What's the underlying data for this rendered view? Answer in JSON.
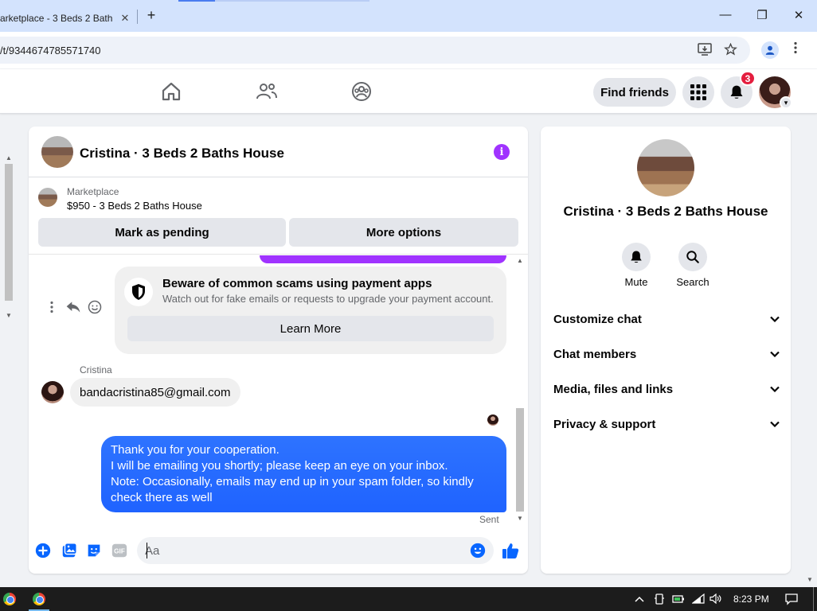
{
  "browser": {
    "tab_title": "arketplace - 3 Beds 2 Bath",
    "tab_close": "✕",
    "new_tab": "+",
    "url": "/t/9344674785571740",
    "window": {
      "minimize": "—",
      "restore": "❐",
      "close": "✕"
    }
  },
  "nav": {
    "find_friends": "Find friends",
    "notification_count": "3"
  },
  "chat": {
    "title": "Cristina · 3 Beds 2 Baths House",
    "info_glyph": "i",
    "marketplace": {
      "label": "Marketplace",
      "item": "$950 - 3 Beds 2 Baths House",
      "mark_pending": "Mark as pending",
      "more_options": "More options"
    },
    "scam_warning": {
      "title": "Beware of common scams using payment apps",
      "description": "Watch out for fake emails or requests to upgrade your payment account.",
      "learn_more": "Learn More"
    },
    "sender_name": "Cristina",
    "their_message": "bandacristina85@gmail.com",
    "my_message_lines": [
      "Thank you for your cooperation.",
      "I will be emailing you shortly; please keep an eye on your inbox.",
      "Note: Occasionally, emails may end up in your spam folder, so kindly",
      "check there as well"
    ],
    "sent_status": "Sent",
    "composer_placeholder": "Aa",
    "gif_label": "GIF"
  },
  "sidebar": {
    "title": "Cristina · 3 Beds 2 Baths House",
    "mute": "Mute",
    "search": "Search",
    "sections": [
      "Customize chat",
      "Chat members",
      "Media, files and links",
      "Privacy & support"
    ]
  },
  "taskbar": {
    "time": "8:23 PM"
  },
  "colors": {
    "fb_blue": "#0866ff",
    "bubble_blue": "#1f63ff",
    "purple": "#a033ff",
    "badge_red": "#e41e3f"
  }
}
